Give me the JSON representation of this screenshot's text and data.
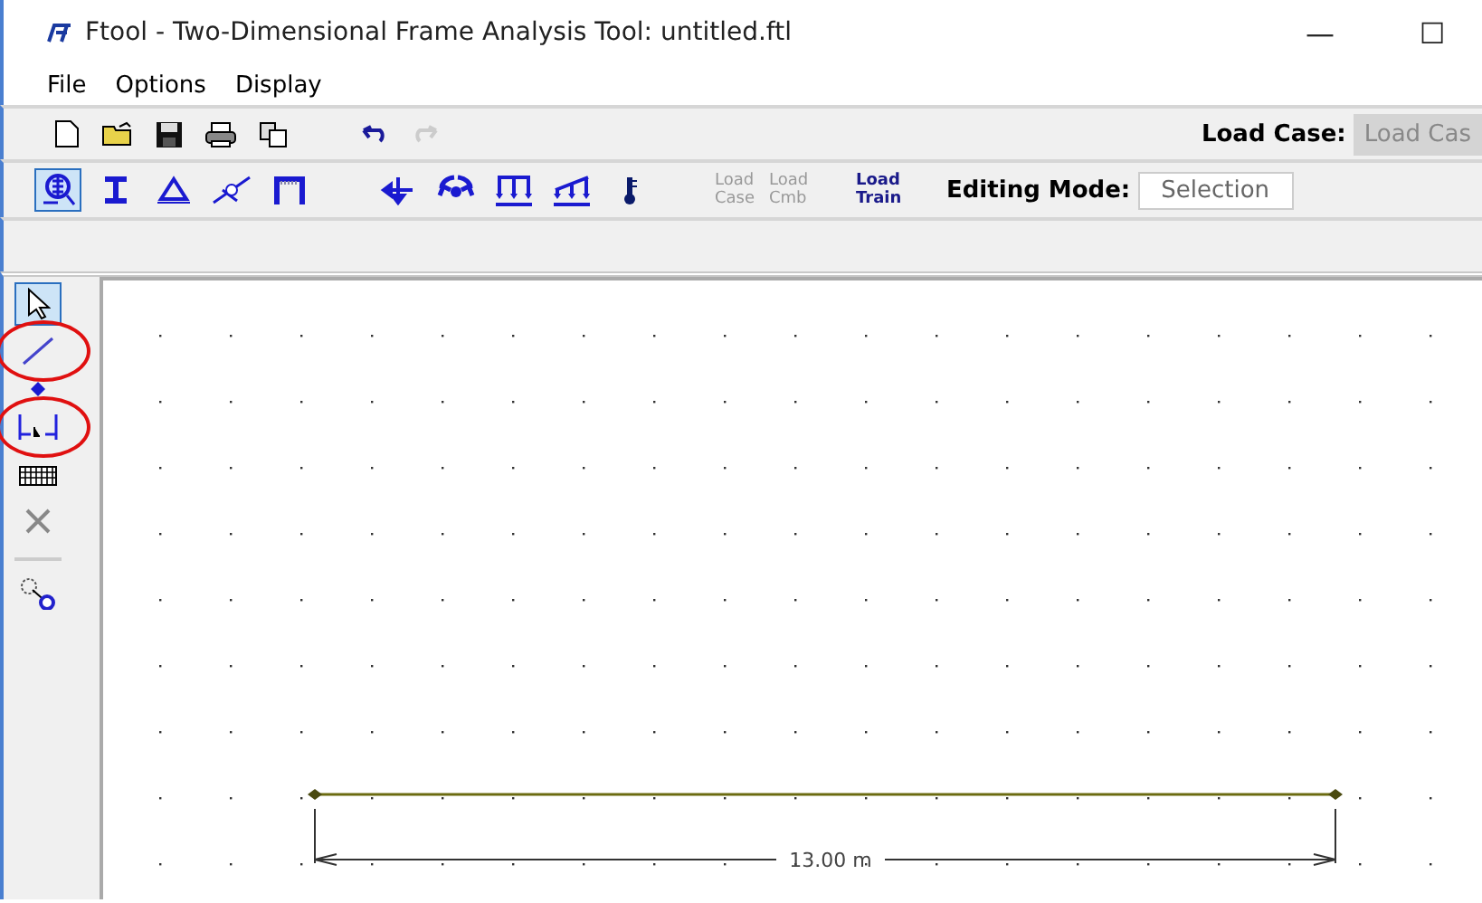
{
  "window": {
    "title": "Ftool - Two-Dimensional Frame Analysis Tool: untitled.ftl",
    "controls": [
      "—",
      "☐"
    ]
  },
  "menu": [
    "File",
    "Options",
    "Display"
  ],
  "toolbar": {
    "tools": [
      {
        "kind": "new",
        "disabled": false
      },
      {
        "kind": "open",
        "disabled": false
      },
      {
        "kind": "save",
        "disabled": false
      },
      {
        "kind": "print",
        "disabled": false
      },
      {
        "kind": "copy",
        "disabled": false
      },
      {
        "kind": "undo",
        "disabled": false
      },
      {
        "kind": "redo",
        "disabled": true
      }
    ],
    "load_case": {
      "label": "Load Case:",
      "value": "Load Cas"
    }
  },
  "model_toolbar": {
    "tools": [
      {
        "kind": "zoom",
        "selected": true
      },
      {
        "kind": "section",
        "selected": false
      },
      {
        "kind": "support",
        "selected": false
      },
      {
        "kind": "hinge",
        "selected": false
      },
      {
        "kind": "frame",
        "selected": false
      },
      {
        "kind": "force",
        "selected": false
      },
      {
        "kind": "moment",
        "selected": false
      },
      {
        "kind": "uniform",
        "selected": false
      },
      {
        "kind": "linear",
        "selected": false
      },
      {
        "kind": "thermal",
        "selected": false
      }
    ],
    "load_buttons": [
      {
        "label": "Load Case",
        "disabled": true
      },
      {
        "label": "Load Cmb",
        "disabled": true
      },
      {
        "label": "Load Train",
        "disabled": false
      }
    ],
    "editing_mode": {
      "label": "Editing Mode:",
      "value": "Selection"
    }
  },
  "side_tool_groups": [
    {
      "tools": [
        {
          "kind": "select",
          "selected": true,
          "circled": false
        },
        {
          "kind": "line",
          "selected": false,
          "circled": true
        },
        {
          "kind": "node",
          "selected": false,
          "circled": false
        },
        {
          "kind": "dimension",
          "selected": false,
          "circled": true
        },
        {
          "kind": "hatch",
          "selected": false,
          "circled": false
        },
        {
          "kind": "delete",
          "selected": false,
          "circled": false
        }
      ]
    },
    {
      "tools": [
        {
          "kind": "probe",
          "selected": false,
          "circled": false
        }
      ]
    }
  ],
  "canvas": {
    "dimension_label": "13.00 m"
  }
}
